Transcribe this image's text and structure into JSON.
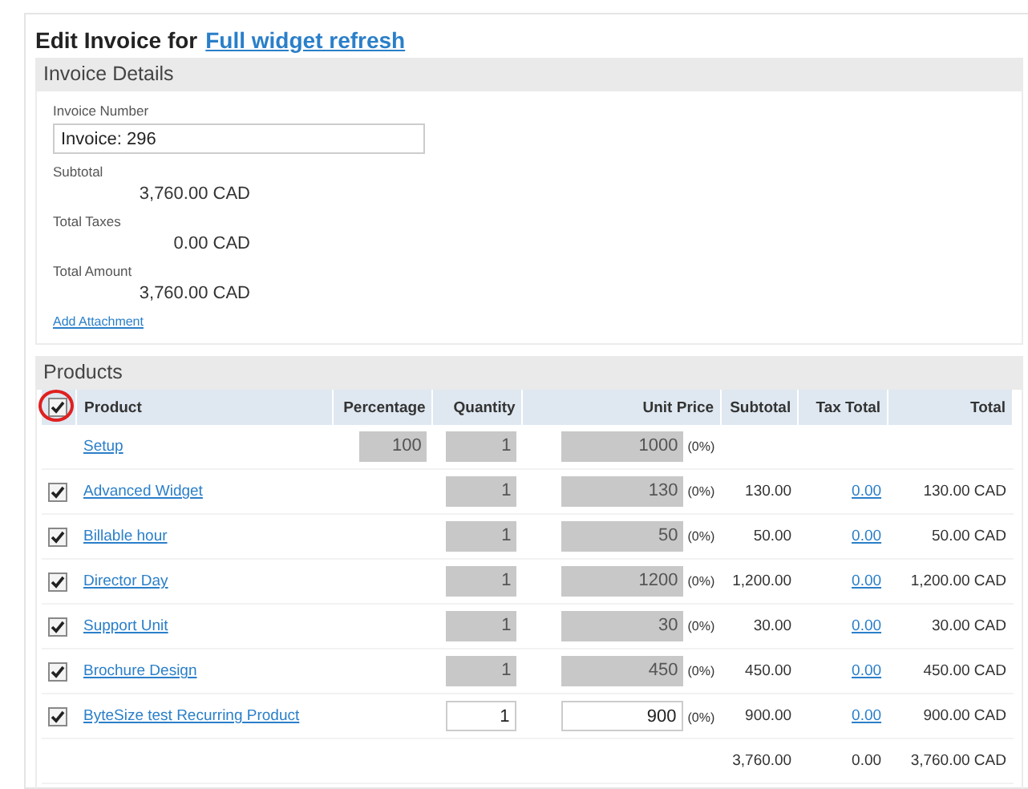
{
  "title": {
    "prefix": "Edit Invoice for",
    "link": "Full widget refresh"
  },
  "details": {
    "heading": "Invoice Details",
    "invoice_number": {
      "label": "Invoice Number",
      "value": "Invoice: 296"
    },
    "fields": [
      {
        "label": "Subtotal",
        "value": "3,760.00 CAD"
      },
      {
        "label": "Total Taxes",
        "value": "0.00 CAD"
      },
      {
        "label": "Total Amount",
        "value": "3,760.00 CAD"
      }
    ],
    "add_attachment": "Add Attachment"
  },
  "products": {
    "heading": "Products",
    "select_all": {
      "checked": true,
      "highlighted": true
    },
    "columns": [
      "Product",
      "Percentage",
      "Quantity",
      "Unit Price",
      "Subtotal",
      "Tax Total",
      "Total"
    ],
    "rows": [
      {
        "kind": "percentage",
        "product": "Setup",
        "percentage": "100",
        "quantity": "1",
        "unit_price": "1000",
        "tax_rate": "(0%)",
        "disabled": true
      },
      {
        "kind": "item",
        "checked": true,
        "product": "Advanced Widget",
        "quantity": "1",
        "unit_price": "130",
        "tax_rate": "(0%)",
        "subtotal": "130.00",
        "tax_total": "0.00",
        "total": "130.00 CAD",
        "disabled": true
      },
      {
        "kind": "item",
        "checked": true,
        "product": "Billable hour",
        "quantity": "1",
        "unit_price": "50",
        "tax_rate": "(0%)",
        "subtotal": "50.00",
        "tax_total": "0.00",
        "total": "50.00 CAD",
        "disabled": true
      },
      {
        "kind": "item",
        "checked": true,
        "product": "Director Day",
        "quantity": "1",
        "unit_price": "1200",
        "tax_rate": "(0%)",
        "subtotal": "1,200.00",
        "tax_total": "0.00",
        "total": "1,200.00 CAD",
        "disabled": true
      },
      {
        "kind": "item",
        "checked": true,
        "product": "Support Unit",
        "quantity": "1",
        "unit_price": "30",
        "tax_rate": "(0%)",
        "subtotal": "30.00",
        "tax_total": "0.00",
        "total": "30.00 CAD",
        "disabled": true
      },
      {
        "kind": "item",
        "checked": true,
        "product": "Brochure Design",
        "quantity": "1",
        "unit_price": "450",
        "tax_rate": "(0%)",
        "subtotal": "450.00",
        "tax_total": "0.00",
        "total": "450.00 CAD",
        "disabled": true
      },
      {
        "kind": "item",
        "checked": true,
        "product": "ByteSize test Recurring Product",
        "quantity": "1",
        "unit_price": "900",
        "tax_rate": "(0%)",
        "subtotal": "900.00",
        "tax_total": "0.00",
        "total": "900.00 CAD",
        "disabled": false
      }
    ],
    "totals": {
      "subtotal": "3,760.00",
      "tax_total": "0.00",
      "total": "3,760.00 CAD"
    }
  }
}
